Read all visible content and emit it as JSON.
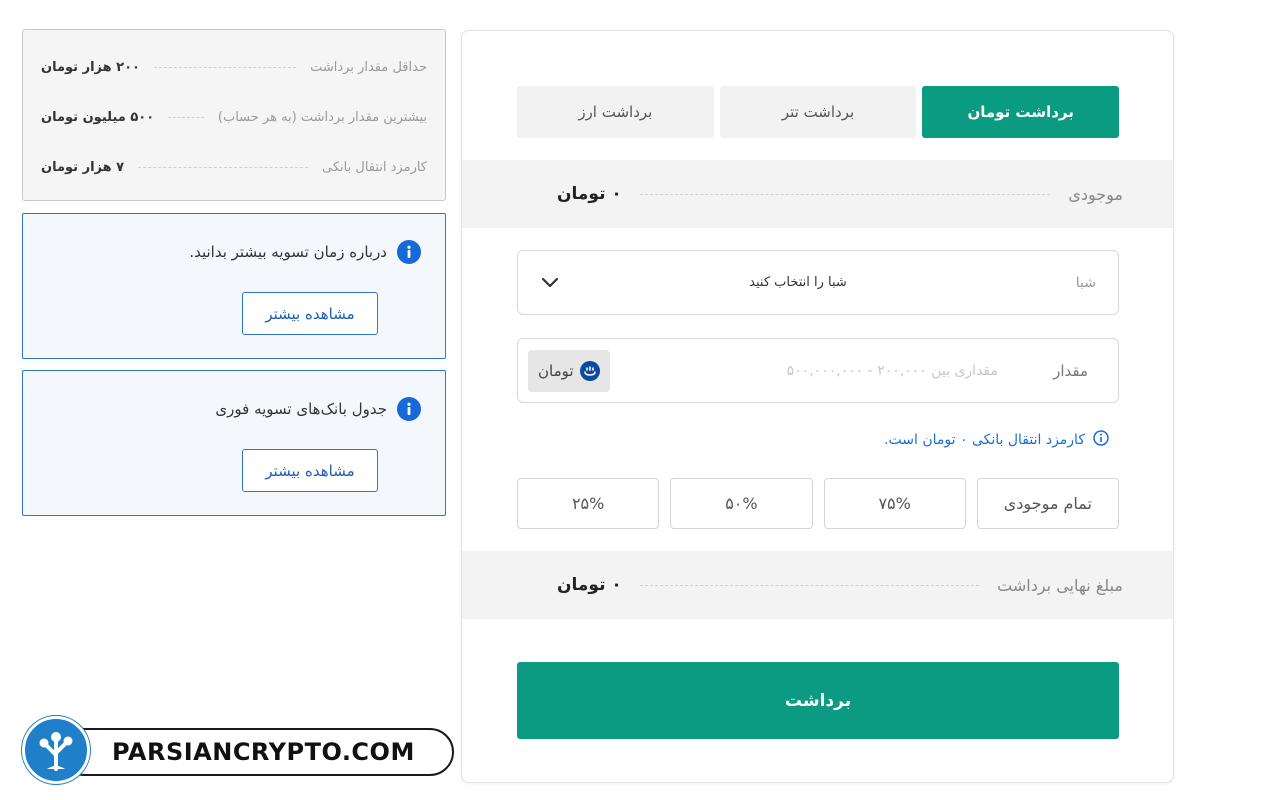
{
  "tabs": [
    {
      "label": "برداشت تومان",
      "active": true
    },
    {
      "label": "برداشت تتر",
      "active": false
    },
    {
      "label": "برداشت ارز",
      "active": false
    }
  ],
  "balance": {
    "label": "موجودی",
    "value": "۰ تومان"
  },
  "sheba": {
    "label": "شبا",
    "value": "شبا را انتخاب کنید"
  },
  "amount": {
    "label": "مقدار",
    "placeholder": "مقداری بین ۲۰۰,۰۰۰ - ۵۰۰,۰۰۰,۰۰۰",
    "unit": "تومان"
  },
  "fee_note": "کارمزد انتقال بانکی ۰ تومان است.",
  "percent_buttons": [
    "تمام موجودی",
    "۷۵%",
    "۵۰%",
    "۲۵%"
  ],
  "final_amount": {
    "label": "مبلغ نهایی برداشت",
    "value": "۰ تومان"
  },
  "withdraw_button": "برداشت",
  "limits": [
    {
      "label": "حداقل مقدار برداشت",
      "value": "۲۰۰ هزار تومان"
    },
    {
      "label": "بیشترین مقدار برداشت (به هر حساب)",
      "value": "۵۰۰ میلیون تومان"
    },
    {
      "label": "کارمزد انتقال بانکی",
      "value": "۷ هزار تومان"
    }
  ],
  "info_boxes": [
    {
      "text": "درباره زمان تسویه بیشتر بدانید.",
      "button": "مشاهده بیشتر"
    },
    {
      "text": "جدول بانک‌های تسویه فوری",
      "button": "مشاهده بیشتر"
    }
  ],
  "watermark": {
    "text": "PARSIANCRYPTO.COM"
  },
  "colors": {
    "accent": "#0a9b82",
    "info_blue": "#1769d8",
    "border_blue": "#2f76c9",
    "band_bg": "#f3f3f3"
  },
  "icons": {
    "info": "info-circle-icon",
    "dropdown": "chevron-down-icon",
    "currency": "toman-icon",
    "logo": "tree-logo-icon"
  }
}
